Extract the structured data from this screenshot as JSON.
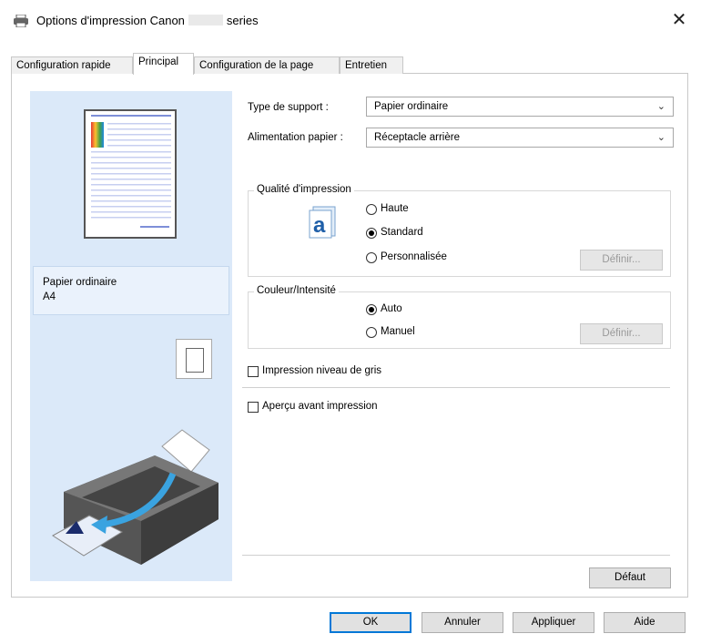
{
  "window": {
    "title_prefix": "Options d'impression Canon",
    "title_suffix": "series",
    "close_glyph": "✕"
  },
  "tabs": [
    {
      "label": "Configuration rapide",
      "active": false
    },
    {
      "label": "Principal",
      "active": true
    },
    {
      "label": "Configuration de la page",
      "active": false
    },
    {
      "label": "Entretien",
      "active": false
    }
  ],
  "preview": {
    "paper_type": "Papier ordinaire",
    "paper_size": "A4"
  },
  "media": {
    "type_label": "Type de support :",
    "type_value": "Papier ordinaire",
    "source_label": "Alimentation papier :",
    "source_value": "Réceptacle arrière"
  },
  "quality": {
    "title": "Qualité d'impression",
    "options": [
      "Haute",
      "Standard",
      "Personnalisée"
    ],
    "selected": "Standard",
    "define_label": "Définir..."
  },
  "color": {
    "title": "Couleur/Intensité",
    "options": [
      "Auto",
      "Manuel"
    ],
    "selected": "Auto",
    "define_label": "Définir..."
  },
  "grayscale_label": "Impression niveau de gris",
  "preview_before_label": "Aperçu avant impression",
  "default_label": "Défaut",
  "footer": {
    "ok": "OK",
    "cancel": "Annuler",
    "apply": "Appliquer",
    "help": "Aide"
  },
  "icons": {
    "printer": "printer-icon",
    "close": "close-icon",
    "chevron": "chevron-down-icon",
    "quality": "quality-letter-a-icon"
  }
}
